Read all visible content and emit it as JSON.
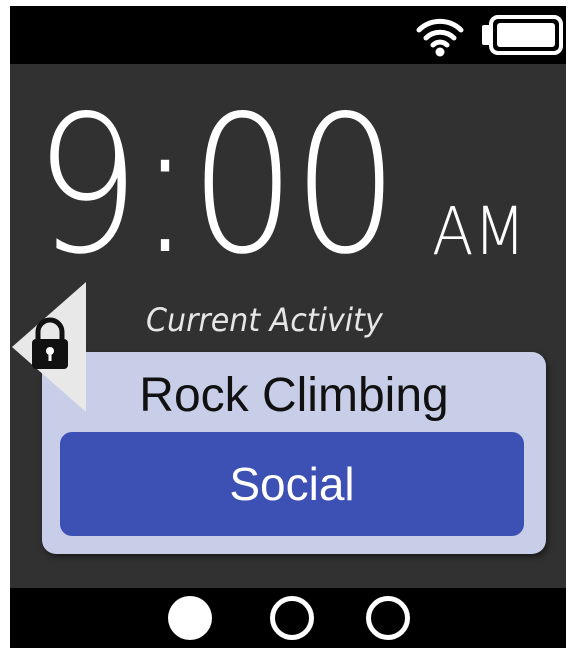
{
  "status_bar": {
    "icons": [
      "wifi-icon",
      "battery-icon"
    ],
    "battery_level": 1.0
  },
  "clock": {
    "time": "9:00",
    "period": "AM"
  },
  "activity": {
    "heading": "Current Activity",
    "name": "Rock Climbing",
    "category": "Social",
    "lock_icon": "lock-icon"
  },
  "page_indicator": {
    "count": 3,
    "active_index": 0
  },
  "colors": {
    "screen_bg": "#313131",
    "bar_bg": "#000000",
    "card_bg": "#c8cde8",
    "category_bg": "#3d50b3",
    "text_primary": "#ffffff"
  }
}
